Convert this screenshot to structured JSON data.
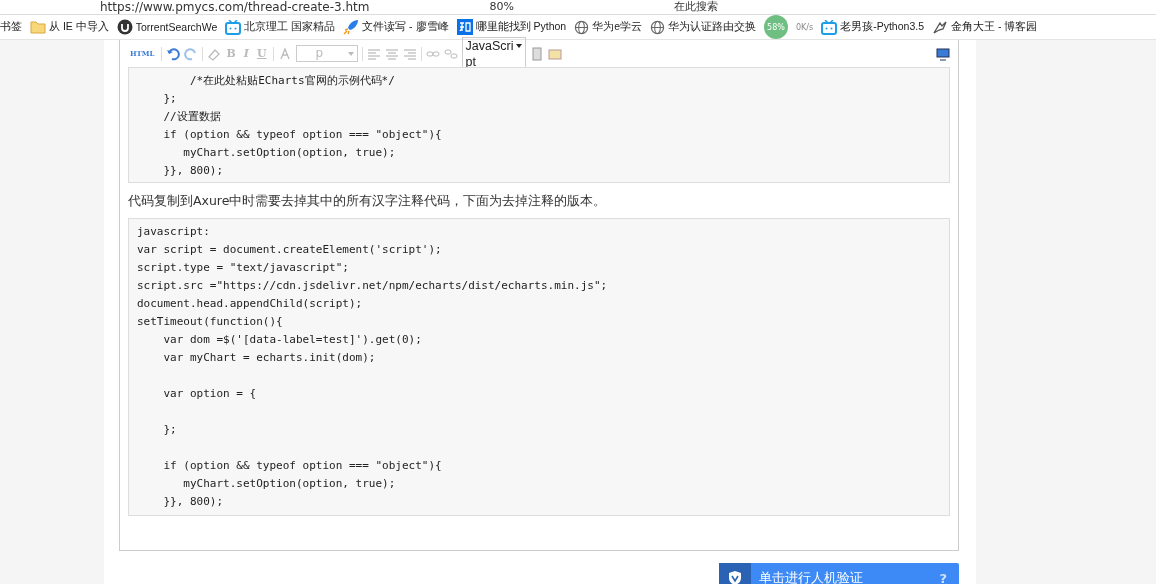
{
  "browser": {
    "url": "https://www.pmycs.com/thread-create-3.htm",
    "zoom": "80%",
    "search_placeholder": "在此搜索",
    "speed_widget": {
      "percent": "58%",
      "rate": "0K/s"
    }
  },
  "bookmarks": [
    {
      "label": "书签"
    },
    {
      "label": "从 IE 中导入"
    },
    {
      "label": "TorrentSearchWe"
    },
    {
      "label": "北京理工 国家精品"
    },
    {
      "label": "文件读写 - 廖雪峰"
    },
    {
      "label": "哪里能找到 Python"
    },
    {
      "label": "华为e学云"
    },
    {
      "label": "华为认证路由交换"
    },
    {
      "label": "老男孩-Python3.5"
    },
    {
      "label": "金角大王 - 博客园"
    }
  ],
  "toolbar": {
    "html": "HTML",
    "bold": "B",
    "italic": "I",
    "underline": "U",
    "format_value": "p",
    "language_value": "JavaScript"
  },
  "code_blocks": [
    {
      "text": "        /*在此处粘贴ECharts官网的示例代码*/\n    };\n    //设置数据\n    if (option && typeof option === \"object\"){\n       myChart.setOption(option, true);\n    }}, 800);"
    },
    {
      "text": "javascript:\nvar script = document.createElement('script');\nscript.type = \"text/javascript\";\nscript.src =\"https://cdn.jsdelivr.net/npm/echarts/dist/echarts.min.js\";\ndocument.head.appendChild(script);\nsetTimeout(function(){\n    var dom =$('[data-label=test]').get(0);\n    var myChart = echarts.init(dom);\n\n    var option = {\n\n    };\n\n    if (option && typeof option === \"object\"){\n       myChart.setOption(option, true);\n    }}, 800);"
    }
  ],
  "paragraph": "代码复制到Axure中时需要去掉其中的所有汉字注释代码，下面为去掉注释的版本。",
  "captcha_button": {
    "label": "单击进行人机验证",
    "help": "?"
  }
}
